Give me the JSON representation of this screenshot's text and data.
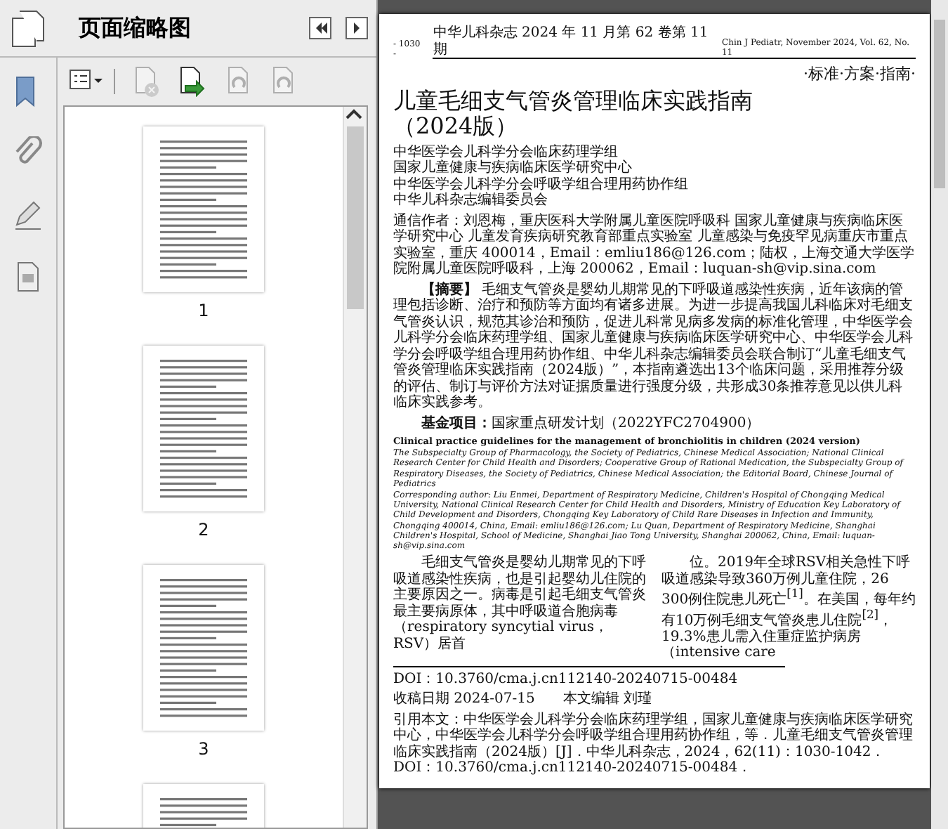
{
  "sidebar": {
    "title": "页面缩略图",
    "rail": [
      {
        "kind": "bookmark"
      },
      {
        "kind": "paperclip"
      },
      {
        "kind": "pen"
      },
      {
        "kind": "document"
      }
    ],
    "toolbar": [
      {
        "kind": "options",
        "disabled": false
      },
      {
        "kind": "delete",
        "disabled": true
      },
      {
        "kind": "insert",
        "disabled": false
      },
      {
        "kind": "rotate-left",
        "disabled": true
      },
      {
        "kind": "rotate-right",
        "disabled": true
      }
    ],
    "thumbnails": [
      {
        "label": "1"
      },
      {
        "label": "2"
      },
      {
        "label": "3"
      }
    ]
  },
  "document": {
    "page_number": "- 1030 -",
    "journal_cn": "中华儿科杂志 2024 年 11 月第 62 卷第 11 期",
    "journal_en": "Chin J Pediatr, November 2024, Vol. 62, No. 11",
    "section": "·标准·方案·指南·",
    "title_lines": [
      "儿童毛细支气管炎管理临床实践指南",
      "（2024版）"
    ],
    "authors": [
      "中华医学会儿科学分会临床药理学组",
      "国家儿童健康与疾病临床医学研究中心",
      "中华医学会儿科学分会呼吸学组合理用药协作组",
      "中华儿科杂志编辑委员会"
    ],
    "correspondence": "通信作者：刘恩梅，重庆医科大学附属儿童医院呼吸科 国家儿童健康与疾病临床医学研究中心 儿童发育疾病研究教育部重点实验室 儿童感染与免疫罕见病重庆市重点实验室，重庆 400014，Email：emliu186@126.com；陆权，上海交通大学医学院附属儿童医院呼吸科，上海 200062，Email：luquan-sh@vip.sina.com",
    "abstract": "**【摘要】** 毛细支气管炎是婴幼儿期常见的下呼吸道感染性疾病，近年该病的管理包括诊断、治疗和预防等方面均有诸多进展。为进一步提高我国儿科临床对毛细支气管炎认识，规范其诊治和预防，促进儿科常见病多发病的标准化管理，中华医学会儿科学分会临床药理学组、国家儿童健康与疾病临床医学研究中心、中华医学会儿科学分会呼吸学组合理用药协作组、中华儿科杂志编辑委员会联合制订“儿童毛细支气管炎管理临床实践指南（2024版）”，本指南遴选出13个临床问题，采用推荐分级的评估、制订与评价方法对证据质量进行强度分级，共形成30条推荐意见以供儿科临床实践参考。",
    "fund": "**基金项目：**国家重点研发计划（2022YFC2704900）",
    "en_title": "Clinical practice guidelines for the management of bronchiolitis in children (2024 version)",
    "en_authors": "The Subspecialty Group of Pharmacology, the Society of Pediatrics, Chinese Medical Association; National Clinical Research Center for Child Health and Disorders; Cooperative Group of Rational Medication, the Subspecialty Group of Respiratory Diseases, the Society of Pediatrics, Chinese Medical Association; the Editorial Board, Chinese Journal of Pediatrics",
    "en_correspondence": "Corresponding author: Liu Enmei, Department of Respiratory Medicine, Children's Hospital of Chongqing Medical University, National Clinical Research Center for Child Health and Disorders, Ministry of Education Key Laboratory of Child Development and Disorders, Chongqing Key Laboratory of Child Rare Diseases in Infection and Immunity, Chongqing 400014, China, Email: emliu186@126.com; Lu Quan, Department of Respiratory Medicine, Shanghai Children's Hospital, School of Medicine, Shanghai Jiao Tong University, Shanghai 200062, China, Email: luquan-sh@vip.sina.com",
    "body_columns": [
      "毛细支气管炎是婴幼儿期常见的下呼吸道感染性疾病，也是引起婴幼儿住院的主要原因之一。病毒是引起毛细支气管炎最主要病原体，其中呼吸道合胞病毒（respiratory syncytial virus，RSV）居首",
      "位。2019年全球RSV相关急性下呼吸道感染导致360万例儿童住院，26 300例住院患儿死亡$^{[1]}$。在美国，每年约有10万例毛细支气管炎患儿住院$^{[2]}$，19.3%患儿需入住重症监护病房（intensive care"
    ],
    "doi": "DOI：10.3760/cma.j.cn112140-20240715-00484",
    "received": "收稿日期 2024-07-15",
    "editor": "本文编辑 刘瑾",
    "citation": "引用本文：中华医学会儿科学分会临床药理学组，国家儿童健康与疾病临床医学研究中心，中华医学会儿科学分会呼吸学组合理用药协作组，等．儿童毛细支气管炎管理临床实践指南（2024版）[J]．中华儿科杂志，2024，62(11)：1030-1042．DOI：10.3760/cma.j.cn112140-20240715-00484．"
  }
}
